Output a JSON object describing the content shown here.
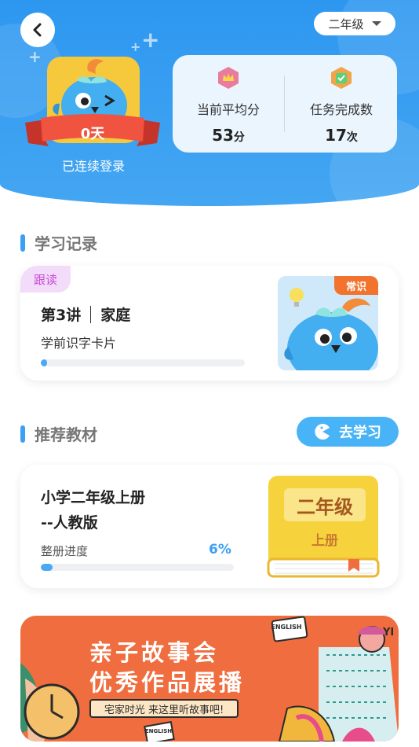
{
  "header": {
    "grade_select": {
      "value": "二年级"
    },
    "streak": {
      "count": "0天",
      "label": "已连续登录"
    },
    "stats": [
      {
        "icon": "crown-badge-icon",
        "label": "当前平均分",
        "value": "53",
        "unit": "分"
      },
      {
        "icon": "task-check-badge-icon",
        "label": "任务完成数",
        "value": "17",
        "unit": "次"
      }
    ]
  },
  "study_record": {
    "section_title": "学习记录",
    "tag": "跟读",
    "lesson": "第3讲",
    "topic": "家庭",
    "subtitle": "学前识字卡片",
    "thumb_tag": "常识",
    "progress": 0.03
  },
  "recommend": {
    "section_title": "推荐教材",
    "go_button": "去学习",
    "book_title_line1": "小学二年级上册",
    "book_title_line2": "--人教版",
    "progress_label": "整册进度",
    "progress_pct": "6%",
    "progress": 0.06,
    "cover_grade": "二年级",
    "cover_volume": "上册"
  },
  "banner": {
    "line1": "亲子故事会",
    "line2": "优秀作品展播",
    "pill": "宅家时光 来这里听故事吧!",
    "sign_text": "ENGLISH",
    "book_text": "ENGLISH",
    "corner_text": "YI"
  },
  "colors": {
    "header_blue": "#2d97f0",
    "accent_blue": "#39a0f5",
    "banner_orange": "#ef6d3e",
    "book_yellow": "#f6d23c",
    "tag_purple": "#c84ad8"
  }
}
